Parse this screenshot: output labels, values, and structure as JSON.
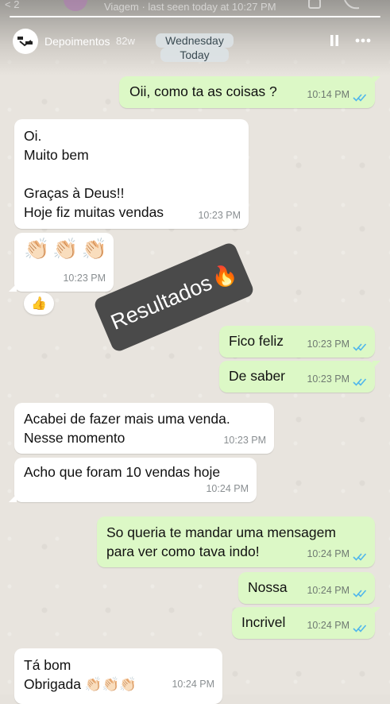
{
  "original_header": {
    "back": "< 2",
    "subtitle": "Viagem · last seen today at 10:27 PM"
  },
  "story": {
    "account_name": "Depoimentos",
    "age": "82w"
  },
  "date_chips": {
    "day": "Wednesday",
    "today": "Today"
  },
  "sticker": {
    "text": "Resultados",
    "emoji": "🔥"
  },
  "reaction": "👍",
  "messages": [
    {
      "text": "Oii, como ta as coisas ?",
      "time": "10:14 PM",
      "dir": "out"
    },
    {
      "text": "Oi.\nMuito bem\n\nGraças à Deus!!\nHoje fiz muitas vendas",
      "time": "10:23 PM",
      "dir": "in"
    },
    {
      "text": "👏🏻👏🏻👏🏻",
      "time": "10:23 PM",
      "dir": "in"
    },
    {
      "text": "Fico feliz",
      "time": "10:23 PM",
      "dir": "out"
    },
    {
      "text": "De saber",
      "time": "10:23 PM",
      "dir": "out"
    },
    {
      "text": "Acabei de fazer mais uma venda.\nNesse momento",
      "time": "10:23 PM",
      "dir": "in"
    },
    {
      "text": "Acho que foram 10 vendas hoje",
      "time": "10:24 PM",
      "dir": "in"
    },
    {
      "text": "So queria te mandar uma mensagem\npara ver como tava indo!",
      "time": "10:24 PM",
      "dir": "out"
    },
    {
      "text": "Nossa",
      "time": "10:24 PM",
      "dir": "out"
    },
    {
      "text": "Incrivel",
      "time": "10:24 PM",
      "dir": "out"
    },
    {
      "text": "Tá bom\nObrigada 👏🏻👏🏻👏🏻",
      "time": "10:24 PM",
      "dir": "in"
    }
  ],
  "colors": {
    "outgoing_bubble": "#dcf8c6",
    "incoming_bubble": "#ffffff",
    "read_ticks": "#4fb6ec",
    "sticker_bg": "#4a4a4a"
  }
}
